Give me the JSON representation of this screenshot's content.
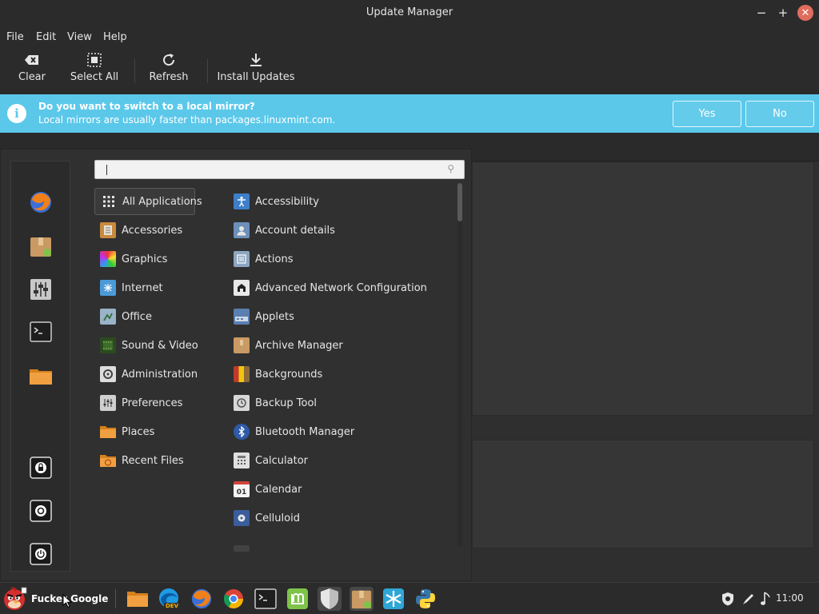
{
  "window": {
    "title": "Update Manager"
  },
  "window_controls": {
    "minimize": "−",
    "maximize": "+",
    "close": "✕"
  },
  "menubar": [
    "File",
    "Edit",
    "View",
    "Help"
  ],
  "toolbar": {
    "clear": "Clear",
    "select_all": "Select All",
    "refresh": "Refresh",
    "install_updates": "Install Updates"
  },
  "infobar": {
    "question": "Do you want to switch to a local mirror?",
    "detail": "Local mirrors are usually faster than packages.linuxmint.com.",
    "yes": "Yes",
    "no": "No",
    "color": "#5bc8ea"
  },
  "start_menu": {
    "search": {
      "value": "",
      "icon": "search-icon"
    },
    "favorites": [
      "firefox-icon",
      "package-icon",
      "settings-mixer-icon",
      "terminal-icon",
      "folder-icon"
    ],
    "session": [
      "lock-screen-icon",
      "logout-icon",
      "power-icon"
    ],
    "categories": [
      {
        "label": "All Applications",
        "icon": "grid-icon"
      },
      {
        "label": "Accessories",
        "icon": "accessories-icon"
      },
      {
        "label": "Graphics",
        "icon": "graphics-icon"
      },
      {
        "label": "Internet",
        "icon": "internet-icon"
      },
      {
        "label": "Office",
        "icon": "office-icon"
      },
      {
        "label": "Sound & Video",
        "icon": "multimedia-icon"
      },
      {
        "label": "Administration",
        "icon": "administration-icon"
      },
      {
        "label": "Preferences",
        "icon": "preferences-icon"
      },
      {
        "label": "Places",
        "icon": "folder-icon"
      },
      {
        "label": "Recent Files",
        "icon": "recent-folder-icon"
      }
    ],
    "selected_category": "All Applications",
    "apps": [
      {
        "label": "Accessibility",
        "icon": "accessibility-icon"
      },
      {
        "label": "Account details",
        "icon": "account-icon"
      },
      {
        "label": "Actions",
        "icon": "actions-icon"
      },
      {
        "label": "Advanced Network Configuration",
        "icon": "network-icon"
      },
      {
        "label": "Applets",
        "icon": "applets-icon"
      },
      {
        "label": "Archive Manager",
        "icon": "archive-icon"
      },
      {
        "label": "Backgrounds",
        "icon": "backgrounds-icon"
      },
      {
        "label": "Backup Tool",
        "icon": "backup-icon"
      },
      {
        "label": "Bluetooth Manager",
        "icon": "bluetooth-icon"
      },
      {
        "label": "Calculator",
        "icon": "calculator-icon"
      },
      {
        "label": "Calendar",
        "icon": "calendar-icon",
        "badge": "01"
      },
      {
        "label": "Celluloid",
        "icon": "celluloid-icon"
      }
    ]
  },
  "taskbar": {
    "menu_label": "Fucker Google",
    "launchers": [
      "folder-icon",
      "edge-dev-icon",
      "firefox-icon",
      "chrome-icon",
      "terminal-icon",
      "mintinstall-icon",
      "shield-icon",
      "update-manager-icon",
      "snowflake-icon",
      "python-icon"
    ],
    "edge_badge": "DEV",
    "tray": [
      "update-shield-icon",
      "network-pen-icon",
      "sound-icon"
    ],
    "clock": "11:00"
  }
}
